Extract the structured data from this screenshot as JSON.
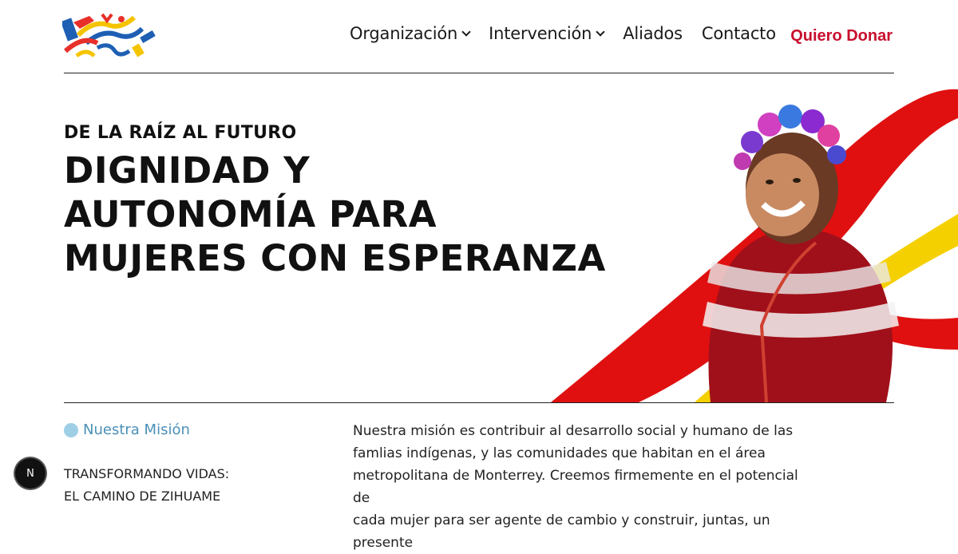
{
  "nav": {
    "items": [
      {
        "label": "Organización",
        "has_dropdown": true
      },
      {
        "label": "Intervención",
        "has_dropdown": true
      },
      {
        "label": "Aliados",
        "has_dropdown": false
      },
      {
        "label": "Contacto",
        "has_dropdown": false
      }
    ],
    "donate_label": "Quiero Donar"
  },
  "hero": {
    "eyebrow": "DE LA RAÍZ AL FUTURO",
    "headline_lines": [
      "DIGNIDAD Y",
      "AUTONOMÍA PARA",
      "MUJERES CON ESPERANZA"
    ]
  },
  "mission": {
    "label": "Nuestra Misión",
    "subtitle_lines": [
      "TRANSFORMANDO VIDAS:",
      "EL CAMINO DE ZIHUAME"
    ],
    "text_lines": [
      "Nuestra misión es contribuir al desarrollo social y humano de las",
      "famlias indígenas, y las comunidades que habitan en el área",
      "metropolitana de Monterrey. Creemos firmemente en el potencial de",
      "cada mujer para ser agente de cambio y construir, juntas, un presente"
    ]
  },
  "fab": {
    "label": "N"
  },
  "colors": {
    "accent_red": "#c8102e",
    "mission_blue": "#4a90b8",
    "dot_blue": "#9fcfe6",
    "stripe_yellow": "#f5d000"
  }
}
